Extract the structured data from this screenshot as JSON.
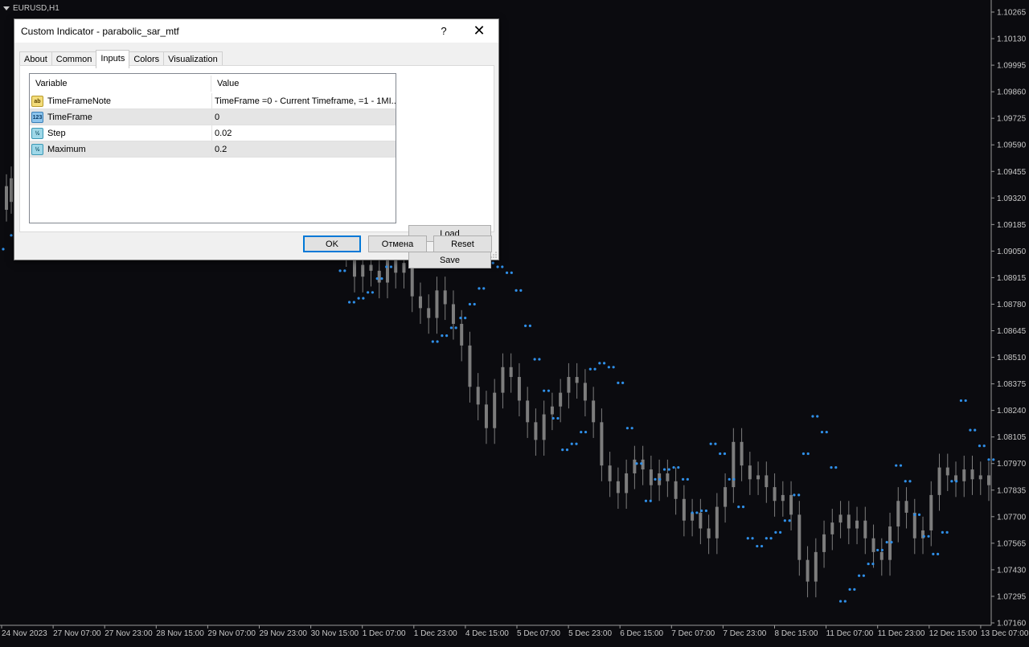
{
  "chart": {
    "symbol_label": "EURUSD,H1",
    "price_labels": [
      "1.10265",
      "1.10130",
      "1.09995",
      "1.09860",
      "1.09725",
      "1.09590",
      "1.09455",
      "1.09320",
      "1.09185",
      "1.09050",
      "1.08915",
      "1.08780",
      "1.08645",
      "1.08510",
      "1.08375",
      "1.08240",
      "1.08105",
      "1.07970",
      "1.07835",
      "1.07700",
      "1.07565",
      "1.07430",
      "1.07295",
      "1.07160"
    ],
    "time_labels": [
      "24 Nov 2023",
      "27 Nov 07:00",
      "27 Nov 23:00",
      "28 Nov 15:00",
      "29 Nov 07:00",
      "29 Nov 23:00",
      "30 Nov 15:00",
      "1 Dec 07:00",
      "1 Dec 23:00",
      "4 Dec 15:00",
      "5 Dec 07:00",
      "5 Dec 23:00",
      "6 Dec 15:00",
      "7 Dec 07:00",
      "7 Dec 23:00",
      "8 Dec 15:00",
      "11 Dec 07:00",
      "11 Dec 23:00",
      "12 Dec 15:00",
      "13 Dec 07:00"
    ],
    "colors": {
      "background": "#0b0b0f",
      "candle": "#7d7d7d",
      "sar_dot": "#2f8fe8",
      "axis_text": "#c8c8c8"
    },
    "candle_closes": [
      1.0931,
      1.0936,
      1.0927,
      1.0905,
      1.0892,
      1.0898,
      1.0895,
      1.0889,
      1.0901,
      1.0894,
      1.0899,
      1.0882,
      1.0876,
      1.0871,
      1.0885,
      1.0878,
      1.0868,
      1.0857,
      1.0836,
      1.0827,
      1.0815,
      1.0833,
      1.0846,
      1.0841,
      1.0829,
      1.0818,
      1.0809,
      1.0822,
      1.0826,
      1.0833,
      1.0841,
      1.0838,
      1.0829,
      1.0818,
      1.0796,
      1.0788,
      1.0782,
      1.0792,
      1.0799,
      1.0794,
      1.0786,
      1.0792,
      1.0788,
      1.0779,
      1.0768,
      1.0772,
      1.0764,
      1.0759,
      1.0775,
      1.0785,
      1.0808,
      1.0796,
      1.0789,
      1.0791,
      1.0785,
      1.0778,
      1.0781,
      1.0771,
      1.0748,
      1.0737,
      1.0752,
      1.0761,
      1.0767,
      1.0771,
      1.0764,
      1.0768,
      1.0759,
      1.0752,
      1.0748,
      1.0765,
      1.0778,
      1.0772,
      1.0759,
      1.0763,
      1.0781,
      1.0795,
      1.0791,
      1.0788,
      1.0794,
      1.0789,
      1.0791,
      1.0786
    ],
    "sar_values": [
      1.0905,
      1.0908,
      1.0895,
      1.0879,
      1.0881,
      1.0884,
      1.0891,
      1.0897,
      1.0903,
      1.091,
      1.0913,
      1.0918,
      1.0859,
      1.0862,
      1.0866,
      1.0871,
      1.0878,
      1.0886,
      1.0899,
      1.0897,
      1.0894,
      1.0885,
      1.0867,
      1.085,
      1.0834,
      1.082,
      1.0804,
      1.0807,
      1.0813,
      1.0845,
      1.0848,
      1.0846,
      1.0838,
      1.0815,
      1.0797,
      1.0778,
      1.0789,
      1.0794,
      1.0795,
      1.0789,
      1.0772,
      1.0773,
      1.0807,
      1.0802,
      1.0789,
      1.0775,
      1.0759,
      1.0755,
      1.0759,
      1.0762,
      1.0768,
      1.0781,
      1.0802,
      1.0821,
      1.0813,
      1.0795,
      1.0727,
      1.0733,
      1.074,
      1.0746,
      1.0753,
      1.0757,
      1.0796,
      1.0788,
      1.0771,
      1.076,
      1.0751,
      1.0762,
      1.0788,
      1.0829,
      1.0814,
      1.0806,
      1.0799
    ]
  },
  "dialog": {
    "title": "Custom Indicator - parabolic_sar_mtf",
    "help": "?",
    "close": "✕",
    "tabs": [
      "About",
      "Common",
      "Inputs",
      "Colors",
      "Visualization"
    ],
    "grid_headers": {
      "variable": "Variable",
      "value": "Value"
    },
    "inputs": [
      {
        "icon": "ab",
        "name": "TimeFrameNote",
        "value": "TimeFrame =0 - Current Timeframe, =1 - 1MI..."
      },
      {
        "icon": "123",
        "name": "TimeFrame",
        "value": "0"
      },
      {
        "icon": "½",
        "name": "Step",
        "value": "0.02"
      },
      {
        "icon": "½",
        "name": "Maximum",
        "value": "0.2"
      }
    ],
    "buttons": {
      "load": "Load",
      "save": "Save",
      "ok": "OK",
      "cancel": "Отмена",
      "reset": "Reset"
    }
  }
}
